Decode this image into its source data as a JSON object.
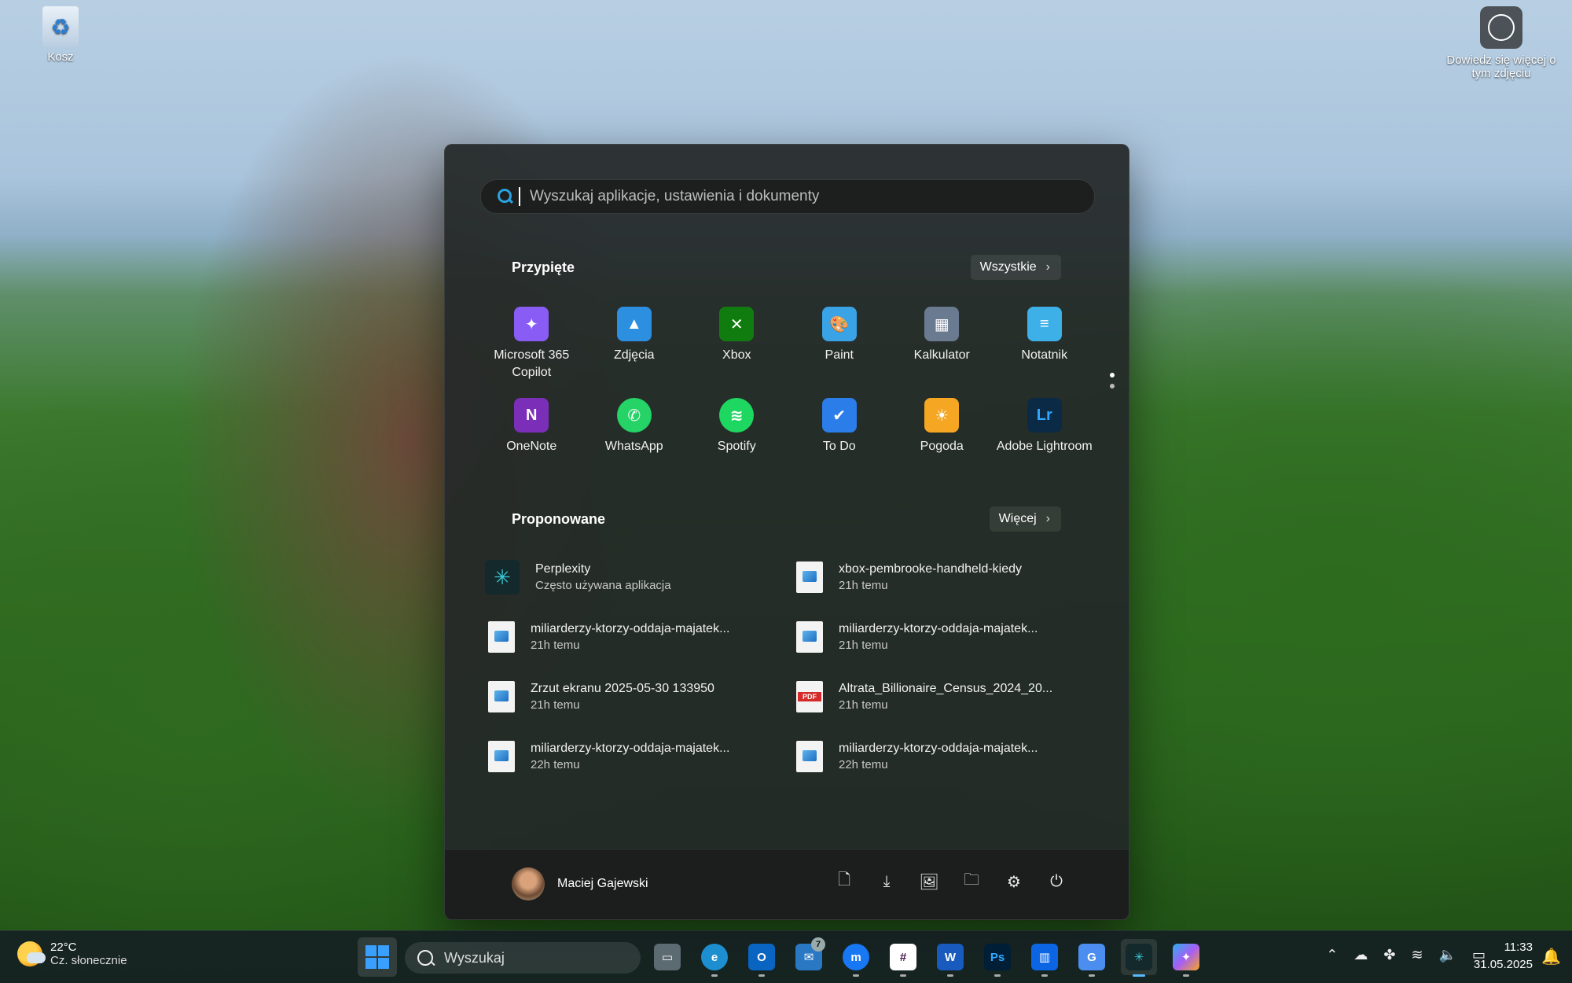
{
  "desktop": {
    "recycle_label": "Kosz",
    "learn_label": "Dowiedz się więcej o tym zdjęciu"
  },
  "start": {
    "search_placeholder": "Wyszukaj aplikacje, ustawienia i dokumenty",
    "pinned_title": "Przypięte",
    "all_label": "Wszystkie",
    "pinned": [
      {
        "label": "Microsoft 365 Copilot",
        "icon": "m365-copilot-icon",
        "color": "#8a5cf6"
      },
      {
        "label": "Zdjęcia",
        "icon": "photos-icon",
        "color": "#2c8fe0"
      },
      {
        "label": "Xbox",
        "icon": "xbox-icon",
        "color": "#107c10"
      },
      {
        "label": "Paint",
        "icon": "paint-icon",
        "color": "#3aa3e6"
      },
      {
        "label": "Kalkulator",
        "icon": "calculator-icon",
        "color": "#6a7a90"
      },
      {
        "label": "Notatnik",
        "icon": "notepad-icon",
        "color": "#3db0e8"
      },
      {
        "label": "OneNote",
        "icon": "onenote-icon",
        "color": "#7b2fb9"
      },
      {
        "label": "WhatsApp",
        "icon": "whatsapp-icon",
        "color": "#25d366"
      },
      {
        "label": "Spotify",
        "icon": "spotify-icon",
        "color": "#1ed760"
      },
      {
        "label": "To Do",
        "icon": "todo-icon",
        "color": "#2b7de9"
      },
      {
        "label": "Pogoda",
        "icon": "weather-icon",
        "color": "#f5a623"
      },
      {
        "label": "Adobe Lightroom",
        "icon": "lightroom-icon",
        "color": "#0a2a45"
      }
    ],
    "recommended_title": "Proponowane",
    "more_label": "Więcej",
    "recommended": [
      {
        "name": "Perplexity",
        "sub": "Często używana aplikacja",
        "kind": "app"
      },
      {
        "name": "xbox-pembrooke-handheld-kiedy",
        "sub": "21h temu",
        "kind": "image"
      },
      {
        "name": "miliarderzy-ktorzy-oddaja-majatek...",
        "sub": "21h temu",
        "kind": "image"
      },
      {
        "name": "miliarderzy-ktorzy-oddaja-majatek...",
        "sub": "21h temu",
        "kind": "image"
      },
      {
        "name": "Zrzut ekranu 2025-05-30 133950",
        "sub": "21h temu",
        "kind": "image"
      },
      {
        "name": "Altrata_Billionaire_Census_2024_20...",
        "sub": "21h temu",
        "kind": "pdf"
      },
      {
        "name": "miliarderzy-ktorzy-oddaja-majatek...",
        "sub": "22h temu",
        "kind": "image"
      },
      {
        "name": "miliarderzy-ktorzy-oddaja-majatek...",
        "sub": "22h temu",
        "kind": "image"
      }
    ],
    "user_name": "Maciej Gajewski"
  },
  "taskbar": {
    "temp": "22°C",
    "weather_desc": "Cz. słonecznie",
    "search_label": "Wyszukaj",
    "badge_count": "7",
    "time": "11:33",
    "date": "31.05.2025"
  }
}
